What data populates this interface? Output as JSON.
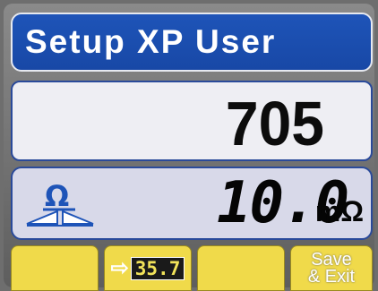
{
  "title": "Setup XP User",
  "setpoint": "705",
  "reading": {
    "value": "10.0",
    "unit": "mΩ",
    "icon": "ohm-meter-icon"
  },
  "softkeys": [
    {
      "label": ""
    },
    {
      "icon": "arrow-right-icon",
      "value": "35.7"
    },
    {
      "label": ""
    },
    {
      "line1": "Save",
      "line2": "& Exit"
    }
  ],
  "colors": {
    "title_bg": "#1e54b8",
    "softkey_bg": "#f0da4a",
    "panel_border": "#2a4a9a"
  }
}
